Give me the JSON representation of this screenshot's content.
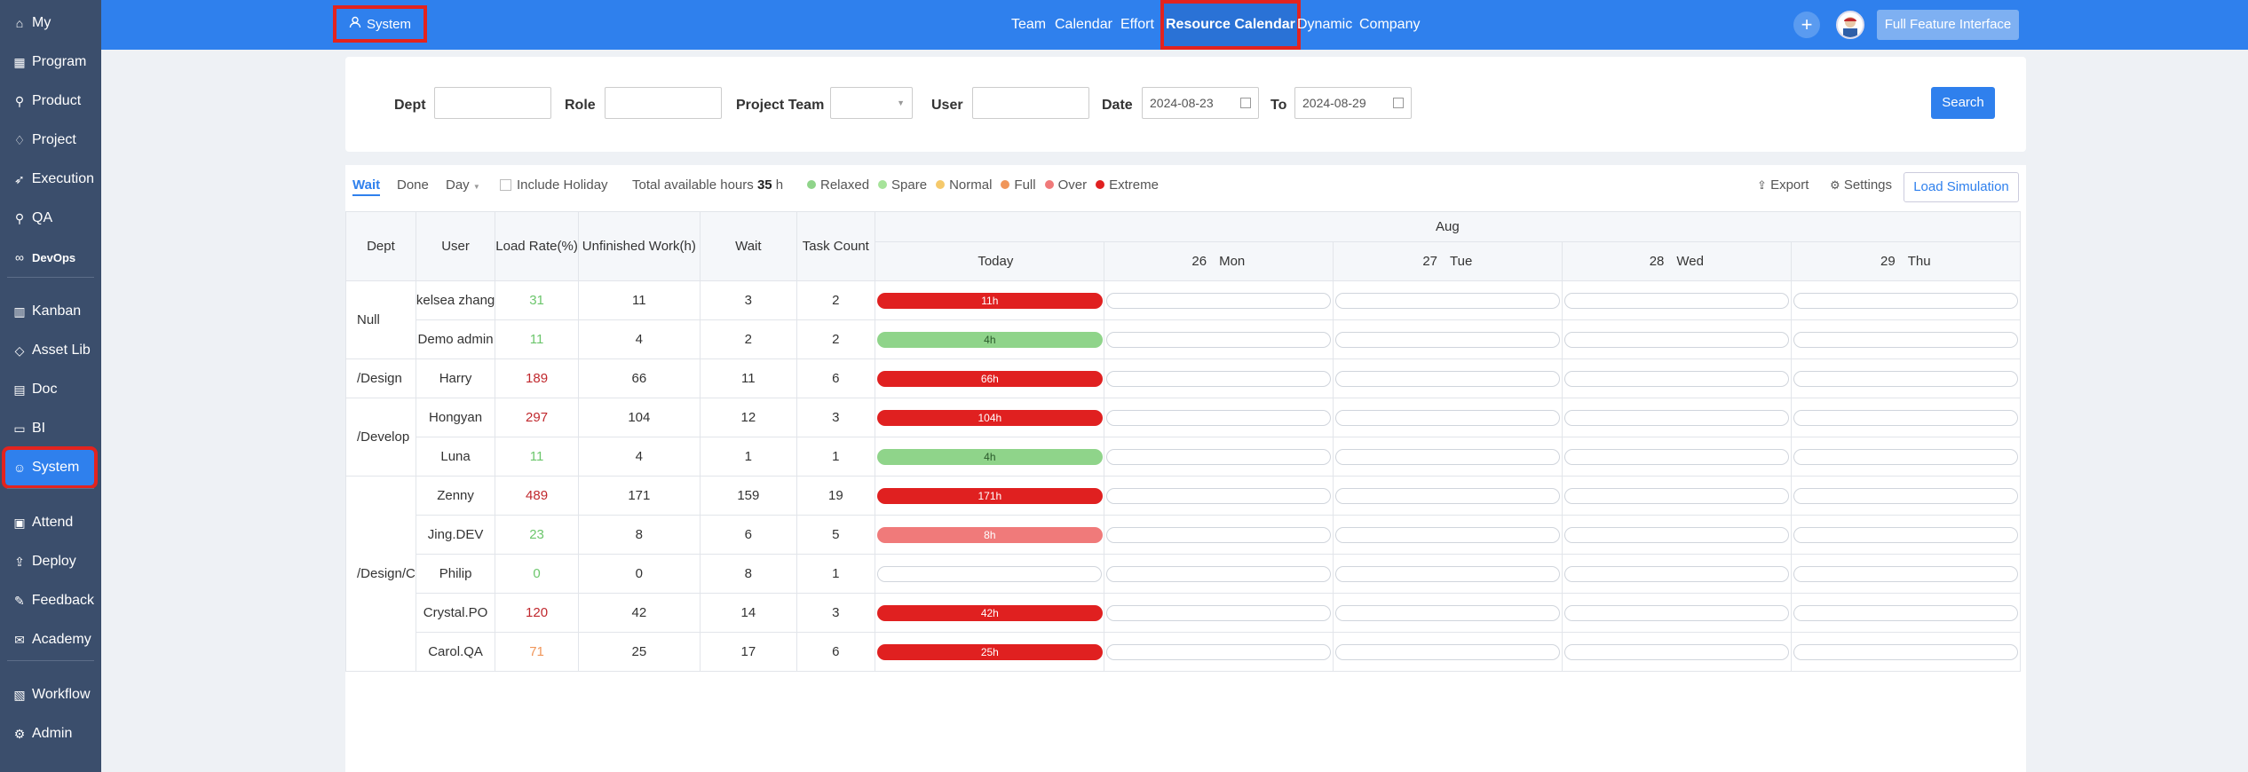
{
  "sidebar": {
    "items": [
      {
        "label": "My",
        "icon": "home-icon"
      },
      {
        "label": "Program",
        "icon": "grid-icon"
      },
      {
        "label": "Product",
        "icon": "pin-icon"
      },
      {
        "label": "Project",
        "icon": "bag-icon"
      },
      {
        "label": "Execution",
        "icon": "rocket-icon"
      },
      {
        "label": "QA",
        "icon": "search-icon"
      },
      {
        "label": "DevOps",
        "icon": "infinity-icon"
      },
      {
        "label": "Kanban",
        "icon": "kanban-icon"
      },
      {
        "label": "Asset Lib",
        "icon": "diamond-icon"
      },
      {
        "label": "Doc",
        "icon": "doc-icon"
      },
      {
        "label": "BI",
        "icon": "monitor-icon"
      },
      {
        "label": "System",
        "icon": "user-icon"
      },
      {
        "label": "Attend",
        "icon": "calendar-icon"
      },
      {
        "label": "Deploy",
        "icon": "deploy-icon"
      },
      {
        "label": "Feedback",
        "icon": "feedback-icon"
      },
      {
        "label": "Academy",
        "icon": "academy-icon"
      },
      {
        "label": "Workflow",
        "icon": "workflow-icon"
      },
      {
        "label": "Admin",
        "icon": "gear-icon"
      }
    ]
  },
  "header": {
    "system_label": "System",
    "nav": [
      "Team",
      "Calendar",
      "Effort",
      "Resource Calendar",
      "Dynamic",
      "Company"
    ],
    "full_feature_label": "Full Feature Interface",
    "plus_label": "+"
  },
  "filters": {
    "dept_label": "Dept",
    "role_label": "Role",
    "project_team_label": "Project Team",
    "user_label": "User",
    "date_label": "Date",
    "date_from": "2024-08-23",
    "to_label": "To",
    "date_to": "2024-08-29",
    "search_label": "Search"
  },
  "toolbar": {
    "wait": "Wait",
    "done": "Done",
    "day": "Day",
    "include_holiday": "Include Holiday",
    "total_hours_prefix": "Total available hours",
    "total_hours_value": "35",
    "total_hours_unit": "h",
    "legend": [
      {
        "label": "Relaxed",
        "color": "#8fd48a"
      },
      {
        "label": "Spare",
        "color": "#a6e39a"
      },
      {
        "label": "Normal",
        "color": "#f5c96b"
      },
      {
        "label": "Full",
        "color": "#f0965a"
      },
      {
        "label": "Over",
        "color": "#f07a7a"
      },
      {
        "label": "Extreme",
        "color": "#e02020"
      }
    ],
    "export": "Export",
    "settings": "Settings",
    "load_simulation": "Load Simulation"
  },
  "table": {
    "headers": {
      "dept": "Dept",
      "user": "User",
      "load_rate": "Load Rate(%)",
      "unfinished": "Unfinished Work(h)",
      "wait": "Wait",
      "task_count": "Task Count",
      "month": "Aug"
    },
    "days": [
      {
        "num": "",
        "name": "Today"
      },
      {
        "num": "26",
        "name": "Mon"
      },
      {
        "num": "27",
        "name": "Tue"
      },
      {
        "num": "28",
        "name": "Wed"
      },
      {
        "num": "29",
        "name": "Thu"
      }
    ],
    "groups": [
      {
        "dept": "Null",
        "rows": [
          {
            "user": "kelsea zhang",
            "load": "31",
            "load_color": "#6cc66c",
            "unfinished": "11",
            "wait": "3",
            "tasks": "2",
            "bar": "11h",
            "bar_color": "#e02020"
          },
          {
            "user": "Demo admin",
            "load": "11",
            "load_color": "#6cc66c",
            "unfinished": "4",
            "wait": "2",
            "tasks": "2",
            "bar": "4h",
            "bar_color": "#8fd48a"
          }
        ]
      },
      {
        "dept": "/Design",
        "rows": [
          {
            "user": "Harry",
            "load": "189",
            "load_color": "#c0282d",
            "unfinished": "66",
            "wait": "11",
            "tasks": "6",
            "bar": "66h",
            "bar_color": "#e02020"
          }
        ]
      },
      {
        "dept": "/Develop",
        "rows": [
          {
            "user": "Hongyan",
            "load": "297",
            "load_color": "#c0282d",
            "unfinished": "104",
            "wait": "12",
            "tasks": "3",
            "bar": "104h",
            "bar_color": "#e02020"
          },
          {
            "user": "Luna",
            "load": "11",
            "load_color": "#6cc66c",
            "unfinished": "4",
            "wait": "1",
            "tasks": "1",
            "bar": "4h",
            "bar_color": "#8fd48a"
          }
        ]
      },
      {
        "dept": "/Design/C",
        "rows": [
          {
            "user": "Zenny",
            "load": "489",
            "load_color": "#c0282d",
            "unfinished": "171",
            "wait": "159",
            "tasks": "19",
            "bar": "171h",
            "bar_color": "#e02020"
          },
          {
            "user": "Jing.DEV",
            "load": "23",
            "load_color": "#6cc66c",
            "unfinished": "8",
            "wait": "6",
            "tasks": "5",
            "bar": "8h",
            "bar_color": "#f07a7a"
          },
          {
            "user": "Philip",
            "load": "0",
            "load_color": "#6cc66c",
            "unfinished": "0",
            "wait": "8",
            "tasks": "1",
            "bar": "",
            "bar_color": ""
          },
          {
            "user": "Crystal.PO",
            "load": "120",
            "load_color": "#c0282d",
            "unfinished": "42",
            "wait": "14",
            "tasks": "3",
            "bar": "42h",
            "bar_color": "#e02020"
          },
          {
            "user": "Carol.QA",
            "load": "71",
            "load_color": "#f0965a",
            "unfinished": "25",
            "wait": "17",
            "tasks": "6",
            "bar": "25h",
            "bar_color": "#e02020"
          }
        ]
      }
    ]
  }
}
